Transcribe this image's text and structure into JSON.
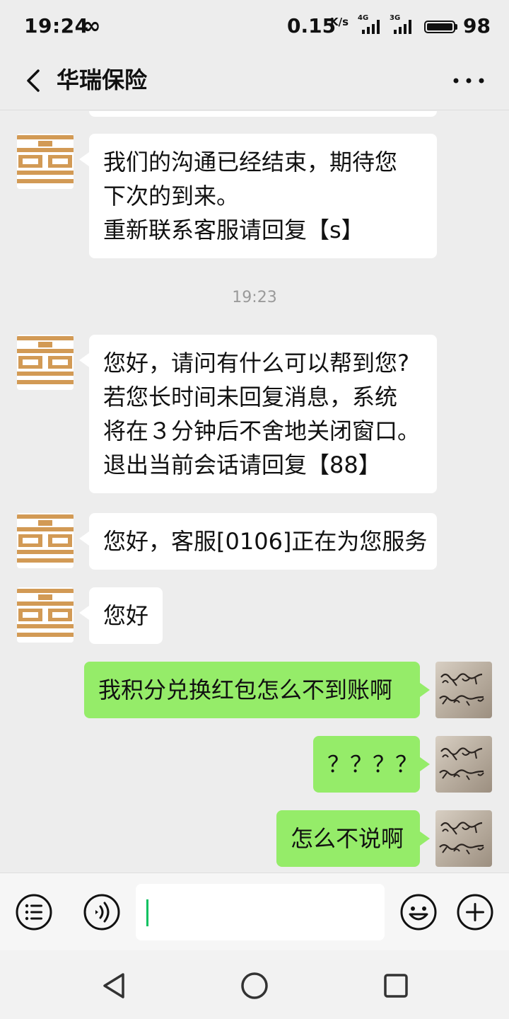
{
  "status_bar": {
    "time": "19:24",
    "infinity": "∞",
    "net_speed": "0.15",
    "net_speed_unit": "K/s",
    "sim1_network": "4G",
    "sim2_network": "3G",
    "battery_level": "98",
    "battery_fraction": 0.98
  },
  "header": {
    "title": "华瑞保险",
    "back_icon": "chevron-left-icon",
    "more_icon": "more-dots-icon"
  },
  "messages": {
    "m1": {
      "sender": "agent",
      "lines": [
        "我们的沟通已经结束，期待您",
        "下次的到来。",
        "重新联系客服请回复【s】"
      ]
    },
    "timestamp": "19:23",
    "m2": {
      "sender": "agent",
      "lines": [
        "您好，请问有什么可以帮到您?",
        "若您长时间未回复消息，系统",
        "将在３分钟后不舍地关闭窗口。",
        "退出当前会话请回复【88】"
      ]
    },
    "m3": {
      "sender": "agent",
      "text": "您好，客服[0106]正在为您服务"
    },
    "m4": {
      "sender": "agent",
      "text": "您好"
    },
    "m5": {
      "sender": "me",
      "text": "我积分兑换红包怎么不到账啊"
    },
    "m6": {
      "sender": "me",
      "text": "？？？？"
    },
    "m7": {
      "sender": "me",
      "text": "怎么不说啊"
    }
  },
  "input_bar": {
    "menu_icon": "list-menu-icon",
    "voice_icon": "voice-icon",
    "input_value": "",
    "emoji_icon": "emoji-icon",
    "plus_icon": "plus-icon"
  },
  "nav_bar": {
    "back_icon": "triangle-back-icon",
    "home_icon": "circle-home-icon",
    "recents_icon": "square-recents-icon"
  },
  "colors": {
    "background": "#ededed",
    "incoming_bubble": "#ffffff",
    "outgoing_bubble": "#95ec69",
    "agent_logo": "#d29a55",
    "cursor": "#07c160"
  }
}
